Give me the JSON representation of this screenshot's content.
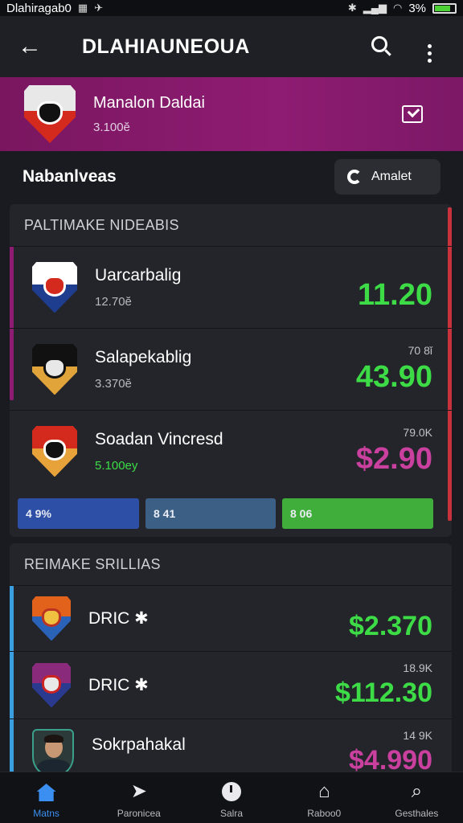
{
  "status_bar": {
    "app_label": "Dlahiragab0",
    "battery_text": "3%",
    "battery_level": 0.8
  },
  "app_bar": {
    "title": "DLAHIAUNEOUA",
    "back_icon": "arrow-left-icon",
    "search_icon": "search-icon",
    "menu_icon": "more-vert-icon"
  },
  "profile": {
    "name": "Manalon Daldai",
    "sub": "3.100ĕ",
    "action_icon": "check-square-icon"
  },
  "section": {
    "title": "Nabanlveas",
    "chip_label": "Amalet"
  },
  "card1": {
    "heading": "PALTIMAKE NIDEABIS",
    "rows": [
      {
        "name": "Uarcarbalig",
        "sub": "12.70ĕ",
        "small": "",
        "value": "11.20",
        "value_color": "#3ddc47",
        "sub_color": "#b8b9bf"
      },
      {
        "name": "Salapekablig",
        "sub": "3.370ĕ",
        "small": "70 8ǐ",
        "value": "43.90",
        "value_color": "#3ddc47",
        "sub_color": "#b8b9bf"
      },
      {
        "name": "Soadan Vincresd",
        "sub": "5.100ey",
        "small": "79.0K",
        "value": "$2.90",
        "value_color": "#c9409e",
        "sub_color": "#3ddc47"
      }
    ],
    "stats": [
      {
        "label": "4 9%",
        "color": "#2d4fa5",
        "fraction": 0.285
      },
      {
        "label": "8 41",
        "color": "#3c5f85",
        "fraction": 0.305
      },
      {
        "label": "8 06",
        "color": "#3fae3a",
        "fraction": 0.355
      }
    ]
  },
  "card2": {
    "heading": "REIMAKE SRILLIAS",
    "rows": [
      {
        "name": "DRIC ✱",
        "sub": "",
        "small": "",
        "value": "$2.370",
        "value_color": "#3ddc47"
      },
      {
        "name": "DRIC ✱",
        "sub": "",
        "small": "18.9K",
        "value": "$112.30",
        "value_color": "#3ddc47"
      },
      {
        "name": "Sokrpahakal",
        "sub": "",
        "small": "14 9K",
        "value": "$4.990",
        "value_color": "#c9409e"
      }
    ]
  },
  "nav": [
    {
      "label": "Matns",
      "icon": "home-icon"
    },
    {
      "label": "Paronicea",
      "icon": "play-icon"
    },
    {
      "label": "Salra",
      "icon": "clock-icon"
    },
    {
      "label": "Raboo0",
      "icon": "bag-icon"
    },
    {
      "label": "Gesthales",
      "icon": "search-icon"
    }
  ],
  "colors": {
    "accent": "#3a8ff0",
    "banner": "#8e1c72",
    "positive": "#3ddc47",
    "negative": "#c9409e"
  }
}
